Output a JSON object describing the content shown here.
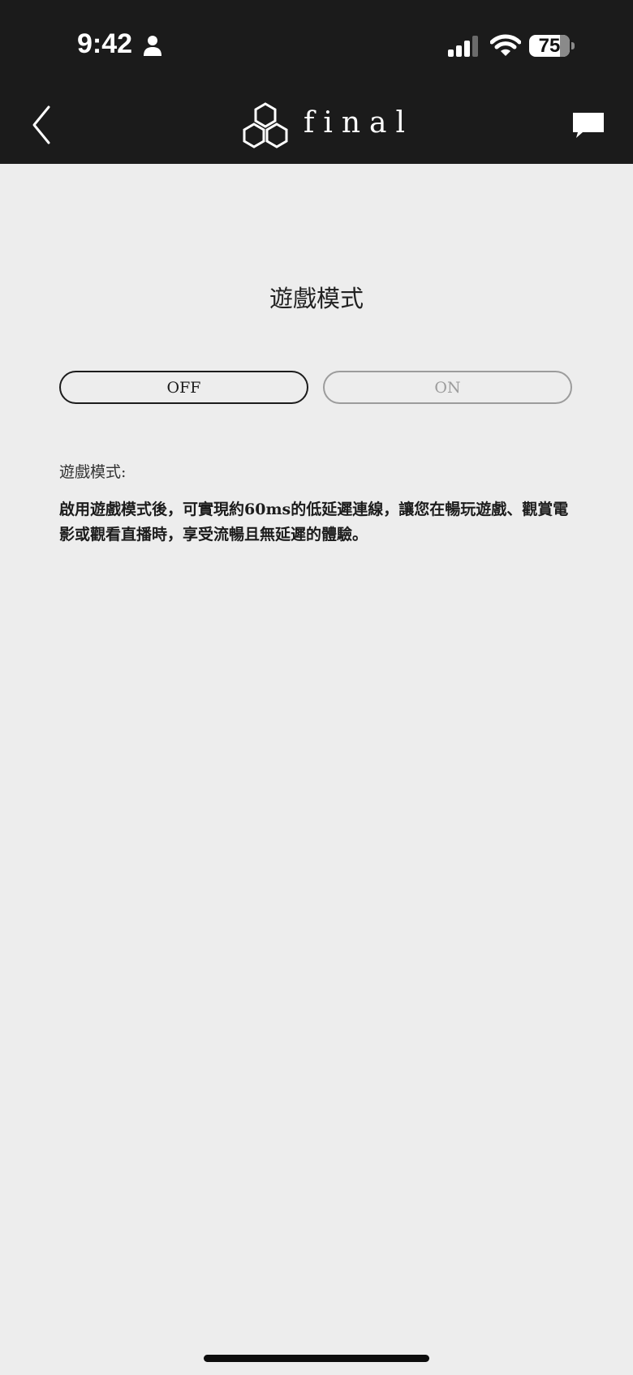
{
  "status_bar": {
    "time": "9:42",
    "battery_level": "75",
    "battery_fraction": 0.75,
    "icons": [
      "person-icon",
      "signal-icon",
      "wifi-icon",
      "battery-icon"
    ]
  },
  "nav": {
    "logo_text": "final",
    "icons": [
      "back-chevron-icon",
      "logo-hexagons-icon",
      "chat-bubble-icon"
    ]
  },
  "page": {
    "title": "遊戲模式",
    "toggle": {
      "off_label": "OFF",
      "on_label": "ON",
      "selected": "OFF"
    },
    "description": {
      "label": "遊戲模式:",
      "text": "啟用遊戲模式後，可實現約60ms的低延遲連線，讓您在暢玩遊戲、觀賞電影或觀看直播時，享受流暢且無延遲的體驗。"
    }
  },
  "colors": {
    "header_background": "#1b1b1b",
    "page_background": "#ededed",
    "selected_border": "#1c1c1c",
    "unselected_border": "#9c9c9c"
  }
}
